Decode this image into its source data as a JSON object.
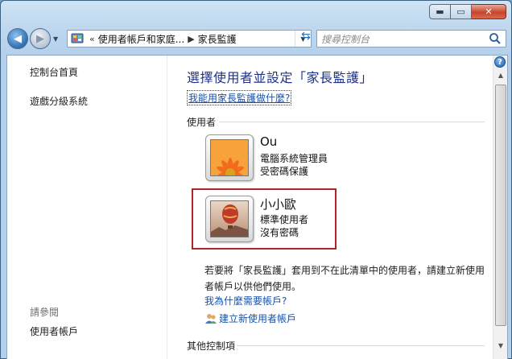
{
  "window": {
    "caption": {
      "minimize": "▬",
      "maximize": "▭",
      "close": "✕"
    }
  },
  "navbar": {
    "address": {
      "overflow": "«",
      "crumb1": "使用者帳戶和家庭...",
      "crumb2": "家長監護"
    },
    "search_placeholder": "搜尋控制台"
  },
  "left_pane": {
    "links": [
      "控制台首頁",
      "遊戲分級系統"
    ],
    "see_also": "請參閱",
    "see_also_links": [
      "使用者帳戶"
    ]
  },
  "main": {
    "title": "選擇使用者並設定「家長監護」",
    "help_link": "我能用家長監護做什麼?",
    "users_section": "使用者",
    "accounts": [
      {
        "name": "Ou",
        "role": "電腦系統管理員",
        "password": "受密碼保護",
        "picture": "flower-picture"
      },
      {
        "name": "小小歐",
        "role": "標準使用者",
        "password": "沒有密碼",
        "picture": "balloon-picture"
      }
    ],
    "info_text": "若要將「家長監護」套用到不在此清單中的使用者，請建立新使用者帳戶以供他們使用。",
    "why_link": "我為什麼需要帳戶?",
    "create_link": "建立新使用者帳戶",
    "other_section": "其他控制項"
  }
}
